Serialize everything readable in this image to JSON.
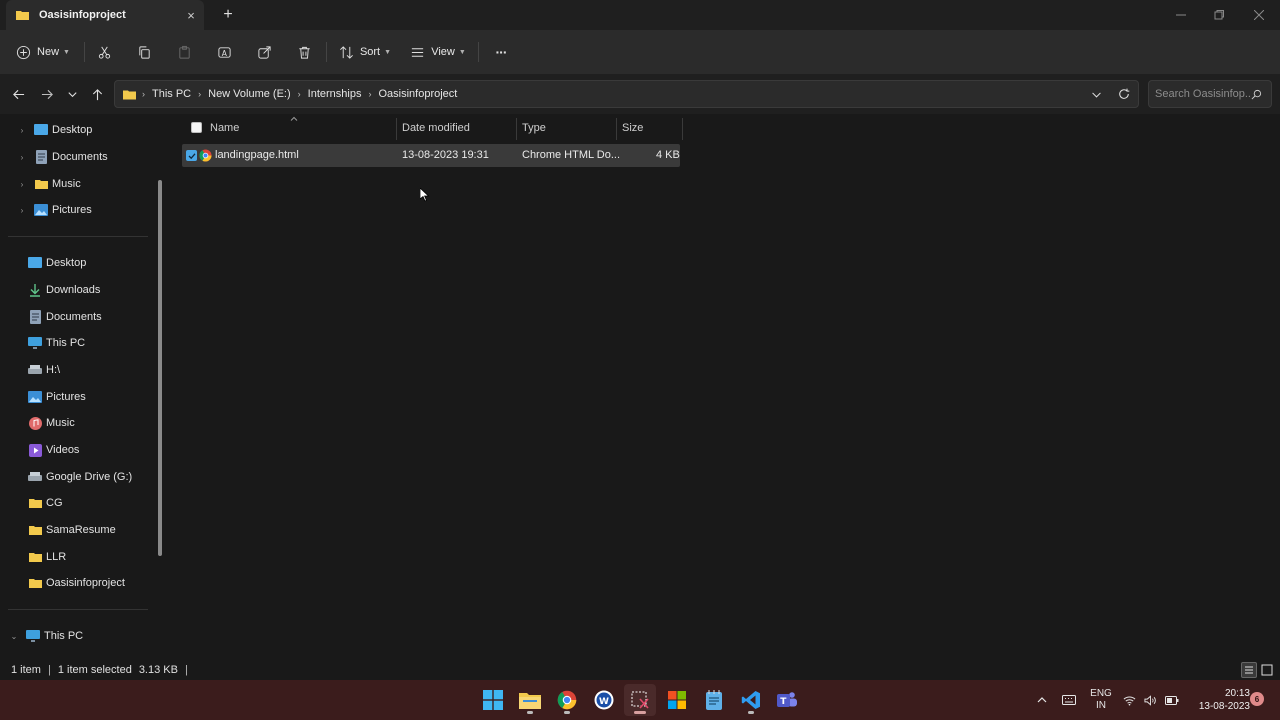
{
  "window": {
    "tab_title": "Oasisinfoproject",
    "close_symbol": "×",
    "newtab_symbol": "+"
  },
  "toolbar": {
    "new_label": "New",
    "sort_label": "Sort",
    "view_label": "View",
    "more_label": "···"
  },
  "address": {
    "crumbs": [
      "This PC",
      "New Volume (E:)",
      "Internships",
      "Oasisinfoproject"
    ],
    "search_placeholder": "Search Oasisinfop..."
  },
  "sidebar": {
    "tree_items": [
      {
        "label": "Desktop",
        "icon": "desktop-icon"
      },
      {
        "label": "Documents",
        "icon": "documents-icon"
      },
      {
        "label": "Music",
        "icon": "folder-icon"
      },
      {
        "label": "Pictures",
        "icon": "pictures-icon"
      }
    ],
    "quick_access": [
      {
        "label": "Desktop",
        "icon": "desktop-icon",
        "pinned": true
      },
      {
        "label": "Downloads",
        "icon": "download-icon",
        "pinned": true
      },
      {
        "label": "Documents",
        "icon": "documents-icon",
        "pinned": true
      },
      {
        "label": "This PC",
        "icon": "computer-icon",
        "pinned": true
      },
      {
        "label": "H:\\",
        "icon": "drive-icon",
        "pinned": true
      },
      {
        "label": "Pictures",
        "icon": "pictures-icon",
        "pinned": true
      },
      {
        "label": "Music",
        "icon": "music-icon",
        "pinned": true
      },
      {
        "label": "Videos",
        "icon": "videos-icon",
        "pinned": true
      },
      {
        "label": "Google Drive (G:)",
        "icon": "drive-icon",
        "pinned": true
      },
      {
        "label": "CG",
        "icon": "folder-icon",
        "pinned": true
      },
      {
        "label": "SamaResume",
        "icon": "folder-icon",
        "pinned": true
      },
      {
        "label": "LLR",
        "icon": "folder-icon",
        "pinned": true
      },
      {
        "label": "Oasisinfoproject",
        "icon": "folder-icon",
        "pinned": false
      }
    ],
    "this_pc_label": "This PC"
  },
  "columns": {
    "name": "Name",
    "date": "Date modified",
    "type": "Type",
    "size": "Size"
  },
  "files": [
    {
      "name": "landingpage.html",
      "date": "13-08-2023 19:31",
      "type": "Chrome HTML Do...",
      "size": "4 KB",
      "selected": true
    }
  ],
  "status": {
    "count": "1 item",
    "selected": "1 item selected",
    "selected_size": "3.13 KB"
  },
  "taskbar": {
    "lang_line1": "ENG",
    "lang_line2": "IN",
    "time": "20:13",
    "date": "13-08-2023",
    "notifications": "6"
  },
  "colors": {
    "accent_folder": "#f2c94c",
    "selection": "#3a3a3a",
    "taskbar": "#3b1c1c"
  }
}
